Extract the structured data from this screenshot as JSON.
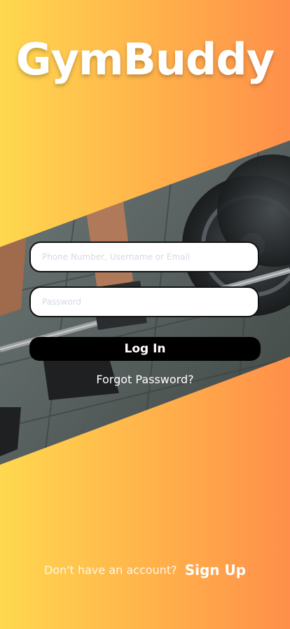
{
  "app": {
    "title": "GymBuddy"
  },
  "login_form": {
    "identifier_placeholder": "Phone Number, Username or Email",
    "password_placeholder": "Password",
    "login_label": "Log In",
    "forgot_label": "Forgot Password?"
  },
  "footer": {
    "prompt": "Don't have an account?",
    "signup_label": "Sign Up"
  },
  "colors": {
    "gradient_start": "#ffd84f",
    "gradient_end": "#ff8f4a",
    "button": "#000000"
  }
}
